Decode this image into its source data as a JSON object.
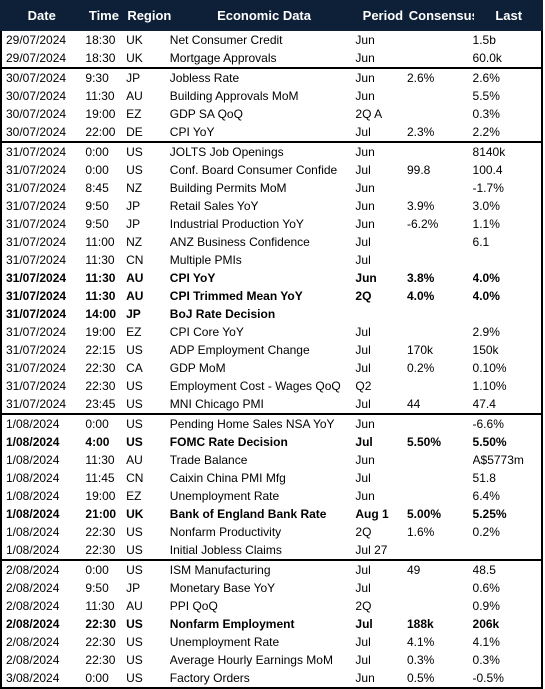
{
  "header": {
    "date": "Date",
    "time": "Time",
    "region": "Region",
    "data": "Economic Data",
    "period": "Period",
    "consensus": "Consensus",
    "last": "Last"
  },
  "groups": [
    {
      "rows": [
        {
          "date": "29/07/2024",
          "time": "18:30",
          "region": "UK",
          "data": "Net Consumer Credit",
          "period": "Jun",
          "consensus": "",
          "last": "1.5b",
          "bold": false
        },
        {
          "date": "29/07/2024",
          "time": "18:30",
          "region": "UK",
          "data": "Mortgage Approvals",
          "period": "Jun",
          "consensus": "",
          "last": "60.0k",
          "bold": false
        }
      ]
    },
    {
      "rows": [
        {
          "date": "30/07/2024",
          "time": "9:30",
          "region": "JP",
          "data": "Jobless Rate",
          "period": "Jun",
          "consensus": "2.6%",
          "last": "2.6%",
          "bold": false
        },
        {
          "date": "30/07/2024",
          "time": "11:30",
          "region": "AU",
          "data": "Building Approvals MoM",
          "period": "Jun",
          "consensus": "",
          "last": "5.5%",
          "bold": false
        },
        {
          "date": "30/07/2024",
          "time": "19:00",
          "region": "EZ",
          "data": "GDP SA QoQ",
          "period": "2Q A",
          "consensus": "",
          "last": "0.3%",
          "bold": false
        },
        {
          "date": "30/07/2024",
          "time": "22:00",
          "region": "DE",
          "data": "CPI YoY",
          "period": "Jul",
          "consensus": "2.3%",
          "last": "2.2%",
          "bold": false
        }
      ]
    },
    {
      "rows": [
        {
          "date": "31/07/2024",
          "time": "0:00",
          "region": "US",
          "data": "JOLTS Job Openings",
          "period": "Jun",
          "consensus": "",
          "last": "8140k",
          "bold": false
        },
        {
          "date": "31/07/2024",
          "time": "0:00",
          "region": "US",
          "data": "Conf. Board Consumer Confide",
          "period": "Jul",
          "consensus": "99.8",
          "last": "100.4",
          "bold": false
        },
        {
          "date": "31/07/2024",
          "time": "8:45",
          "region": "NZ",
          "data": "Building Permits MoM",
          "period": "Jun",
          "consensus": "",
          "last": "-1.7%",
          "bold": false
        },
        {
          "date": "31/07/2024",
          "time": "9:50",
          "region": "JP",
          "data": "Retail Sales YoY",
          "period": "Jun",
          "consensus": "3.9%",
          "last": "3.0%",
          "bold": false
        },
        {
          "date": "31/07/2024",
          "time": "9:50",
          "region": "JP",
          "data": "Industrial Production YoY",
          "period": "Jun",
          "consensus": "-6.2%",
          "last": "1.1%",
          "bold": false
        },
        {
          "date": "31/07/2024",
          "time": "11:00",
          "region": "NZ",
          "data": "ANZ Business Confidence",
          "period": "Jul",
          "consensus": "",
          "last": "6.1",
          "bold": false
        },
        {
          "date": "31/07/2024",
          "time": "11:30",
          "region": "CN",
          "data": "Multiple PMIs",
          "period": "Jul",
          "consensus": "",
          "last": "",
          "bold": false
        },
        {
          "date": "31/07/2024",
          "time": "11:30",
          "region": "AU",
          "data": "CPI YoY",
          "period": "Jun",
          "consensus": "3.8%",
          "last": "4.0%",
          "bold": true
        },
        {
          "date": "31/07/2024",
          "time": "11:30",
          "region": "AU",
          "data": "CPI Trimmed Mean YoY",
          "period": "2Q",
          "consensus": "4.0%",
          "last": "4.0%",
          "bold": true
        },
        {
          "date": "31/07/2024",
          "time": "14:00",
          "region": "JP",
          "data": "BoJ Rate Decision",
          "period": "",
          "consensus": "",
          "last": "",
          "bold": true
        },
        {
          "date": "31/07/2024",
          "time": "19:00",
          "region": "EZ",
          "data": "CPI Core YoY",
          "period": "Jul",
          "consensus": "",
          "last": "2.9%",
          "bold": false
        },
        {
          "date": "31/07/2024",
          "time": "22:15",
          "region": "US",
          "data": "ADP Employment Change",
          "period": "Jul",
          "consensus": "170k",
          "last": "150k",
          "bold": false
        },
        {
          "date": "31/07/2024",
          "time": "22:30",
          "region": "CA",
          "data": "GDP MoM",
          "period": "Jul",
          "consensus": "0.2%",
          "last": "0.10%",
          "bold": false
        },
        {
          "date": "31/07/2024",
          "time": "22:30",
          "region": "US",
          "data": "Employment Cost - Wages QoQ",
          "period": "Q2",
          "consensus": "",
          "last": "1.10%",
          "bold": false
        },
        {
          "date": "31/07/2024",
          "time": "23:45",
          "region": "US",
          "data": "MNI Chicago PMI",
          "period": "Jul",
          "consensus": "44",
          "last": "47.4",
          "bold": false
        }
      ]
    },
    {
      "rows": [
        {
          "date": "1/08/2024",
          "time": "0:00",
          "region": "US",
          "data": "Pending Home Sales NSA YoY",
          "period": "Jun",
          "consensus": "",
          "last": "-6.6%",
          "bold": false
        },
        {
          "date": "1/08/2024",
          "time": "4:00",
          "region": "US",
          "data": "FOMC Rate Decision",
          "period": "Jul",
          "consensus": "5.50%",
          "last": "5.50%",
          "bold": true
        },
        {
          "date": "1/08/2024",
          "time": "11:30",
          "region": "AU",
          "data": "Trade Balance",
          "period": "Jun",
          "consensus": "",
          "last": "A$5773m",
          "bold": false
        },
        {
          "date": "1/08/2024",
          "time": "11:45",
          "region": "CN",
          "data": "Caixin China PMI Mfg",
          "period": "Jul",
          "consensus": "",
          "last": "51.8",
          "bold": false
        },
        {
          "date": "1/08/2024",
          "time": "19:00",
          "region": "EZ",
          "data": "Unemployment Rate",
          "period": "Jun",
          "consensus": "",
          "last": "6.4%",
          "bold": false
        },
        {
          "date": "1/08/2024",
          "time": "21:00",
          "region": "UK",
          "data": "Bank of England Bank Rate",
          "period": "Aug 1",
          "consensus": "5.00%",
          "last": "5.25%",
          "bold": true
        },
        {
          "date": "1/08/2024",
          "time": "22:30",
          "region": "US",
          "data": "Nonfarm Productivity",
          "period": "2Q",
          "consensus": "1.6%",
          "last": "0.2%",
          "bold": false
        },
        {
          "date": "1/08/2024",
          "time": "22:30",
          "region": "US",
          "data": "Initial Jobless Claims",
          "period": "Jul 27",
          "consensus": "",
          "last": "",
          "bold": false
        }
      ]
    },
    {
      "rows": [
        {
          "date": "2/08/2024",
          "time": "0:00",
          "region": "US",
          "data": "ISM Manufacturing",
          "period": "Jul",
          "consensus": "49",
          "last": "48.5",
          "bold": false
        },
        {
          "date": "2/08/2024",
          "time": "9:50",
          "region": "JP",
          "data": "Monetary Base YoY",
          "period": "Jul",
          "consensus": "",
          "last": "0.6%",
          "bold": false
        },
        {
          "date": "2/08/2024",
          "time": "11:30",
          "region": "AU",
          "data": "PPI QoQ",
          "period": "2Q",
          "consensus": "",
          "last": "0.9%",
          "bold": false
        },
        {
          "date": "2/08/2024",
          "time": "22:30",
          "region": "US",
          "data": "Nonfarm Employment",
          "period": "Jul",
          "consensus": "188k",
          "last": "206k",
          "bold": true
        },
        {
          "date": "2/08/2024",
          "time": "22:30",
          "region": "US",
          "data": "Unemployment Rate",
          "period": "Jul",
          "consensus": "4.1%",
          "last": "4.1%",
          "bold": false
        },
        {
          "date": "2/08/2024",
          "time": "22:30",
          "region": "US",
          "data": "Average Hourly Earnings MoM",
          "period": "Jul",
          "consensus": "0.3%",
          "last": "0.3%",
          "bold": false
        },
        {
          "date": "3/08/2024",
          "time": "0:00",
          "region": "US",
          "data": "Factory Orders",
          "period": "Jun",
          "consensus": "0.5%",
          "last": "-0.5%",
          "bold": false
        }
      ]
    }
  ]
}
